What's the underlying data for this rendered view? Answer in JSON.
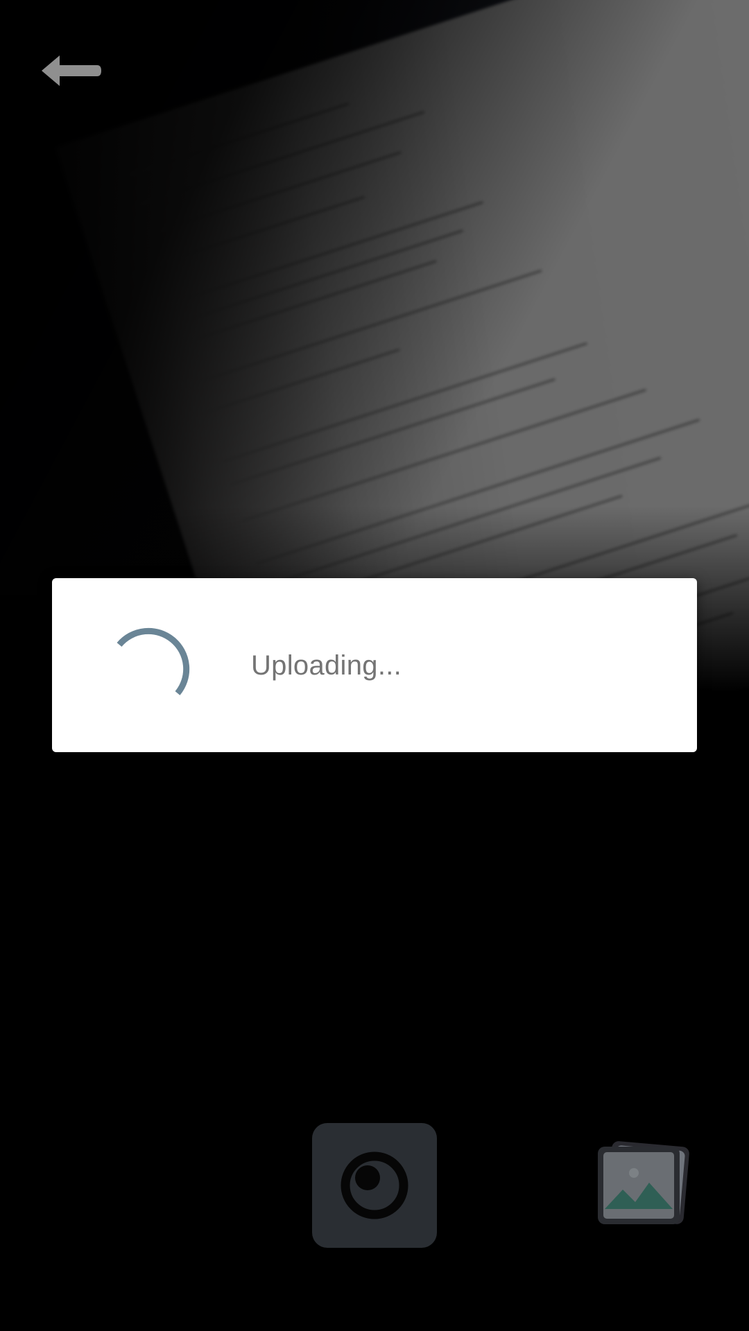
{
  "app": {
    "screen": "document-camera-upload"
  },
  "navigation": {
    "back_icon": "back-arrow-icon"
  },
  "dialog": {
    "message": "Uploading...",
    "indicator_icon": "loading-spinner-icon",
    "accent_color": "#6a8596"
  },
  "controls": {
    "capture_icon": "camera-shutter-icon",
    "gallery_icon": "gallery-image-icon"
  },
  "colors": {
    "background": "#000000",
    "dialog_background": "#ffffff",
    "dialog_text": "#747474",
    "capture_button_bg": "#2a2e33"
  }
}
